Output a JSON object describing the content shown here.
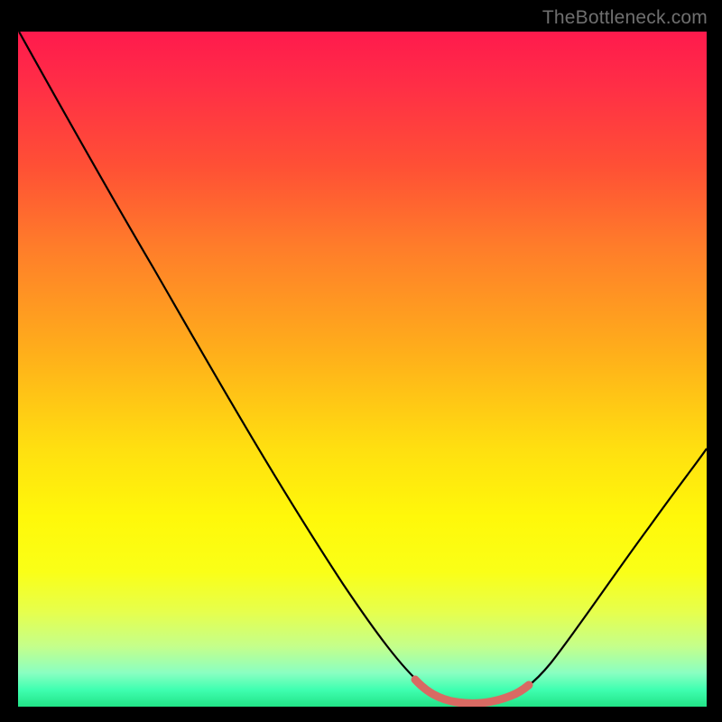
{
  "watermark": "TheBottleneck.com",
  "colors": {
    "frame": "#000000",
    "curve": "#000000",
    "highlight": "#d96a63",
    "gradient_top": "#ff1a4d",
    "gradient_bottom": "#22e386"
  },
  "chart_data": {
    "type": "line",
    "title": "",
    "xlabel": "",
    "ylabel": "",
    "xlim": [
      0,
      100
    ],
    "ylim": [
      0,
      100
    ],
    "x": [
      0,
      5,
      10,
      15,
      20,
      25,
      30,
      35,
      40,
      45,
      50,
      55,
      58,
      62,
      66,
      70,
      73,
      76,
      80,
      85,
      90,
      95,
      100
    ],
    "y": [
      100,
      91,
      82,
      73,
      64,
      55,
      46,
      37,
      29,
      21,
      14,
      8,
      4,
      1.5,
      0.5,
      0.5,
      0.8,
      2,
      6,
      13,
      22,
      31,
      38
    ],
    "highlight_segment": {
      "x": [
        58,
        62,
        66,
        70,
        73
      ],
      "y": [
        3.2,
        1.5,
        0.8,
        1.0,
        1.8
      ]
    },
    "annotations": []
  }
}
